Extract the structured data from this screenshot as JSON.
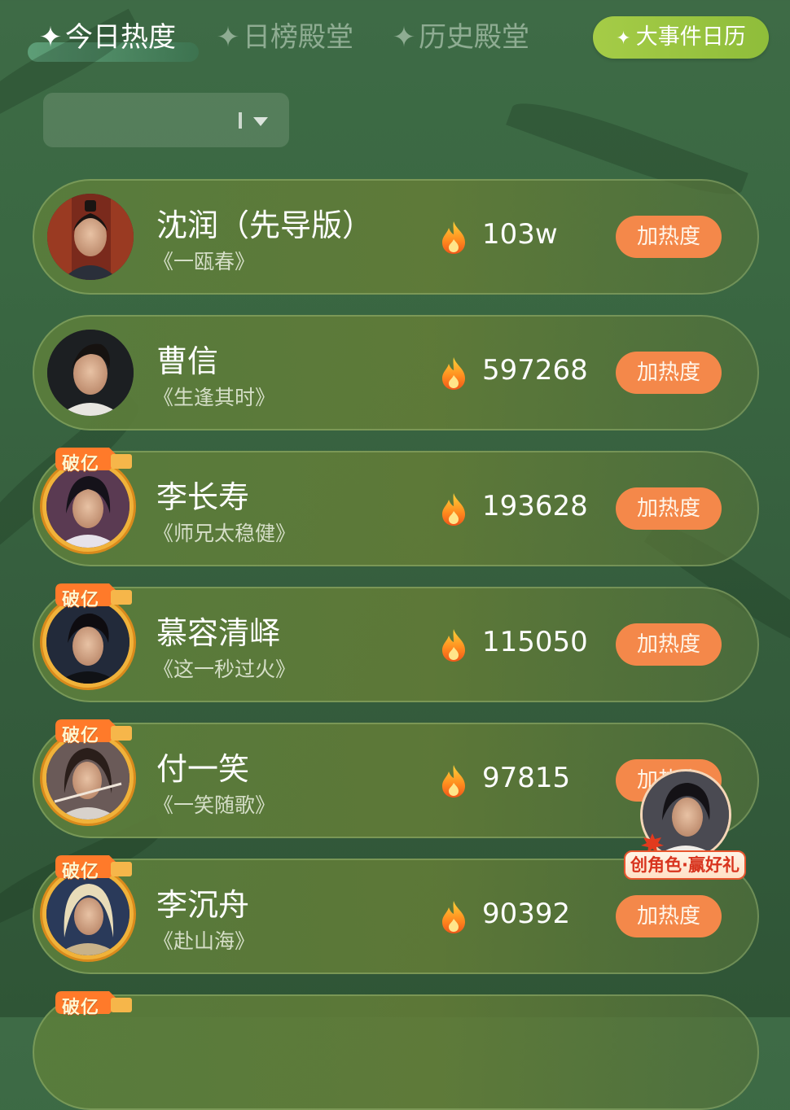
{
  "tabs": [
    {
      "label": "今日热度",
      "active": true
    },
    {
      "label": "日榜殿堂",
      "active": false
    },
    {
      "label": "历史殿堂",
      "active": false
    }
  ],
  "event_button": {
    "label": "大事件日历"
  },
  "star_glyph": "✦",
  "dropdown": {
    "value": ""
  },
  "rows": [
    {
      "name": "沈润（先导版）",
      "drama": "《一瓯春》",
      "heat": "103w",
      "button": "加热度",
      "badge": ""
    },
    {
      "name": "曹信",
      "drama": "《生逢其时》",
      "heat": "597268",
      "button": "加热度",
      "badge": ""
    },
    {
      "name": "李长寿",
      "drama": "《师兄太稳健》",
      "heat": "193628",
      "button": "加热度",
      "badge": "破亿"
    },
    {
      "name": "慕容清峄",
      "drama": "《这一秒过火》",
      "heat": "115050",
      "button": "加热度",
      "badge": "破亿"
    },
    {
      "name": "付一笑",
      "drama": "《一笑随歌》",
      "heat": "97815",
      "button": "加热度",
      "badge": "破亿"
    },
    {
      "name": "李沉舟",
      "drama": "《赴山海》",
      "heat": "90392",
      "button": "加热度",
      "badge": "破亿"
    },
    {
      "name": "",
      "drama": "",
      "heat": "",
      "button": "",
      "badge": "破亿"
    }
  ],
  "float_promo": {
    "label": "创角色·赢好礼"
  },
  "colors": {
    "background": "#3a6842",
    "heat_button": "#f4884a",
    "event_button": "#9cc640",
    "badge_gold": "#f0b23a"
  }
}
